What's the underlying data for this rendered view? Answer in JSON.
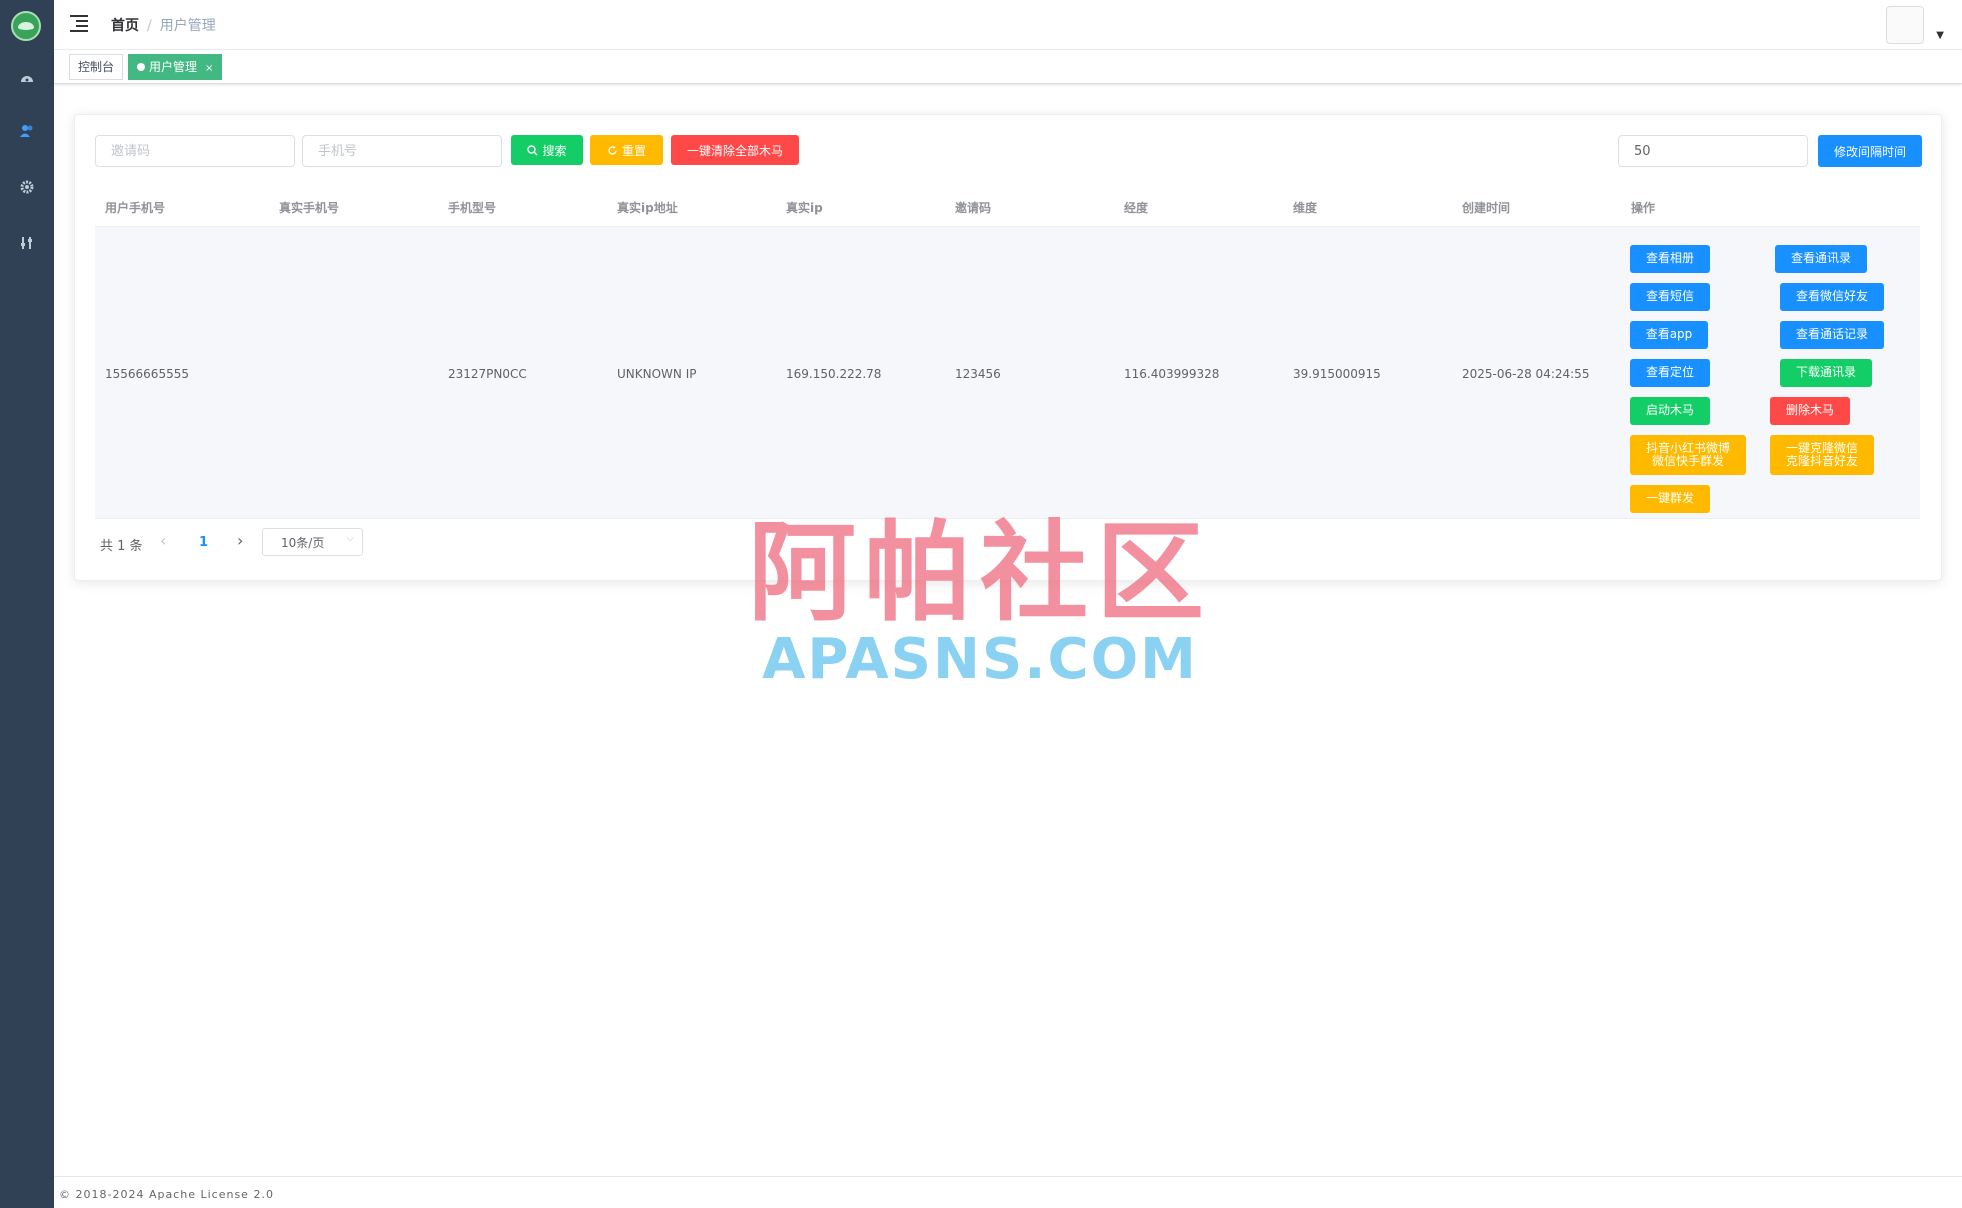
{
  "sidebar": {
    "icons": [
      "dashboard-icon",
      "users-icon",
      "gear-icon",
      "tools-icon"
    ]
  },
  "navbar": {
    "breadcrumb_home": "首页",
    "breadcrumb_sep": "/",
    "breadcrumb_current": "用户管理"
  },
  "tags": {
    "console": "控制台",
    "user_mgmt": "用户管理",
    "close": "×"
  },
  "filters": {
    "invite_placeholder": "邀请码",
    "phone_placeholder": "手机号",
    "search_label": "搜索",
    "reset_label": "重置",
    "clear_all_label": "一键清除全部木马",
    "interval_value": "50",
    "modify_interval_label": "修改间隔时间"
  },
  "table": {
    "headers": [
      "用户手机号",
      "真实手机号",
      "手机型号",
      "真实ip地址",
      "真实ip",
      "邀请码",
      "经度",
      "维度",
      "创建时间",
      "操作"
    ],
    "rows": [
      {
        "user_phone": "15566665555",
        "real_phone": "",
        "model": "23127PN0CC",
        "ip_addr": "UNKNOWN IP",
        "ip": "169.150.222.78",
        "invite": "123456",
        "lng": "116.403999328",
        "lat": "39.915000915",
        "created": "2025-06-28 04:24:55"
      }
    ],
    "actions": {
      "view_album": "查看相册",
      "view_contacts": "查看通讯录",
      "view_sms": "查看短信",
      "view_wechat_friends": "查看微信好友",
      "view_app": "查看app",
      "view_call_log": "查看通话记录",
      "view_location": "查看定位",
      "download_contacts": "下载通讯录",
      "start_trojan": "启动木马",
      "delete_trojan": "删除木马",
      "mass_send_line1": "抖音小红书微博",
      "mass_send_line2": "微信快手群发",
      "clone_line1": "一键克隆微信",
      "clone_line2": "克隆抖音好友",
      "one_click_send": "一键群发"
    }
  },
  "pagination": {
    "total": "共 1 条",
    "prev": "‹",
    "page": "1",
    "next": "›",
    "page_size": "10条/页"
  },
  "footer": {
    "text": "© 2018-2024 Apache License 2.0"
  },
  "watermark": {
    "cn": "阿帕社区",
    "en": "APASNS.COM"
  },
  "colors": {
    "sidebar": "#304156",
    "green": "#13ce66",
    "orange": "#ffba00",
    "red": "#ff4949",
    "blue": "#1890ff",
    "tag_active": "#42b983"
  }
}
